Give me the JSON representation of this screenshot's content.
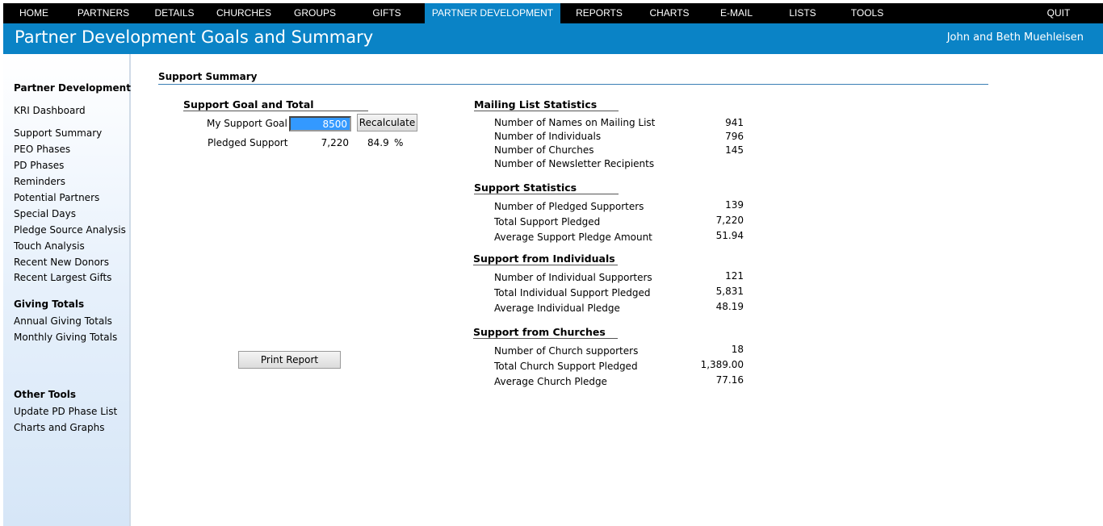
{
  "nav": {
    "items": [
      "HOME",
      "PARTNERS",
      "DETAILS",
      "CHURCHES",
      "GROUPS",
      "GIFTS",
      "PARTNER DEVELOPMENT",
      "REPORTS",
      "CHARTS",
      "E-MAIL",
      "LISTS",
      "TOOLS",
      "QUIT"
    ],
    "active": "PARTNER DEVELOPMENT"
  },
  "header": {
    "title": "Partner Development Goals and Summary",
    "user": "John and Beth Muehleisen"
  },
  "sidebar": {
    "pd_heading": "Partner Development",
    "kri": "KRI Dashboard",
    "pd_items": [
      "Support Summary",
      "PEO Phases",
      "PD Phases",
      "Reminders",
      "Potential Partners",
      "Special Days",
      "Pledge Source Analysis",
      "Touch Analysis",
      "Recent New Donors",
      "Recent Largest Gifts"
    ],
    "giving_heading": "Giving Totals",
    "giving_items": [
      "Annual Giving Totals",
      "Monthly Giving Totals"
    ],
    "tools_heading": "Other Tools",
    "tools_items": [
      "Update PD Phase List",
      "Charts and Graphs"
    ]
  },
  "main": {
    "section_title": "Support Summary",
    "goal": {
      "title": "Support Goal and Total",
      "goal_label": "My Support Goal",
      "goal_value": "8500",
      "recalc_label": "Recalculate",
      "pledged_label": "Pledged Support",
      "pledged_value": "7,220",
      "percent_value": "84.9",
      "percent_sign": "%"
    },
    "print_label": "Print Report",
    "mailing": {
      "title": "Mailing List Statistics",
      "rows": [
        {
          "label": "Number of Names on Mailing List",
          "value": "941"
        },
        {
          "label": "Number of Individuals",
          "value": "796"
        },
        {
          "label": "Number of Churches",
          "value": "145"
        },
        {
          "label": "Number of Newsletter Recipients",
          "value": ""
        }
      ]
    },
    "support": {
      "title": "Support Statistics",
      "rows": [
        {
          "label": "Number of Pledged Supporters",
          "value": "139"
        },
        {
          "label": "Total Support Pledged",
          "value": "7,220"
        },
        {
          "label": "Average Support Pledge Amount",
          "value": "51.94"
        }
      ]
    },
    "individuals": {
      "title": "Support from Individuals",
      "rows": [
        {
          "label": "Number of Individual Supporters",
          "value": "121"
        },
        {
          "label": "Total Individual Support Pledged",
          "value": "5,831"
        },
        {
          "label": "Average Individual Pledge",
          "value": "48.19"
        }
      ]
    },
    "churches": {
      "title": "Support from Churches",
      "rows": [
        {
          "label": "Number of Church supporters",
          "value": "18"
        },
        {
          "label": "Total Church Support Pledged",
          "value": "1,389.00"
        },
        {
          "label": "Average Church Pledge",
          "value": "77.16"
        }
      ]
    }
  }
}
